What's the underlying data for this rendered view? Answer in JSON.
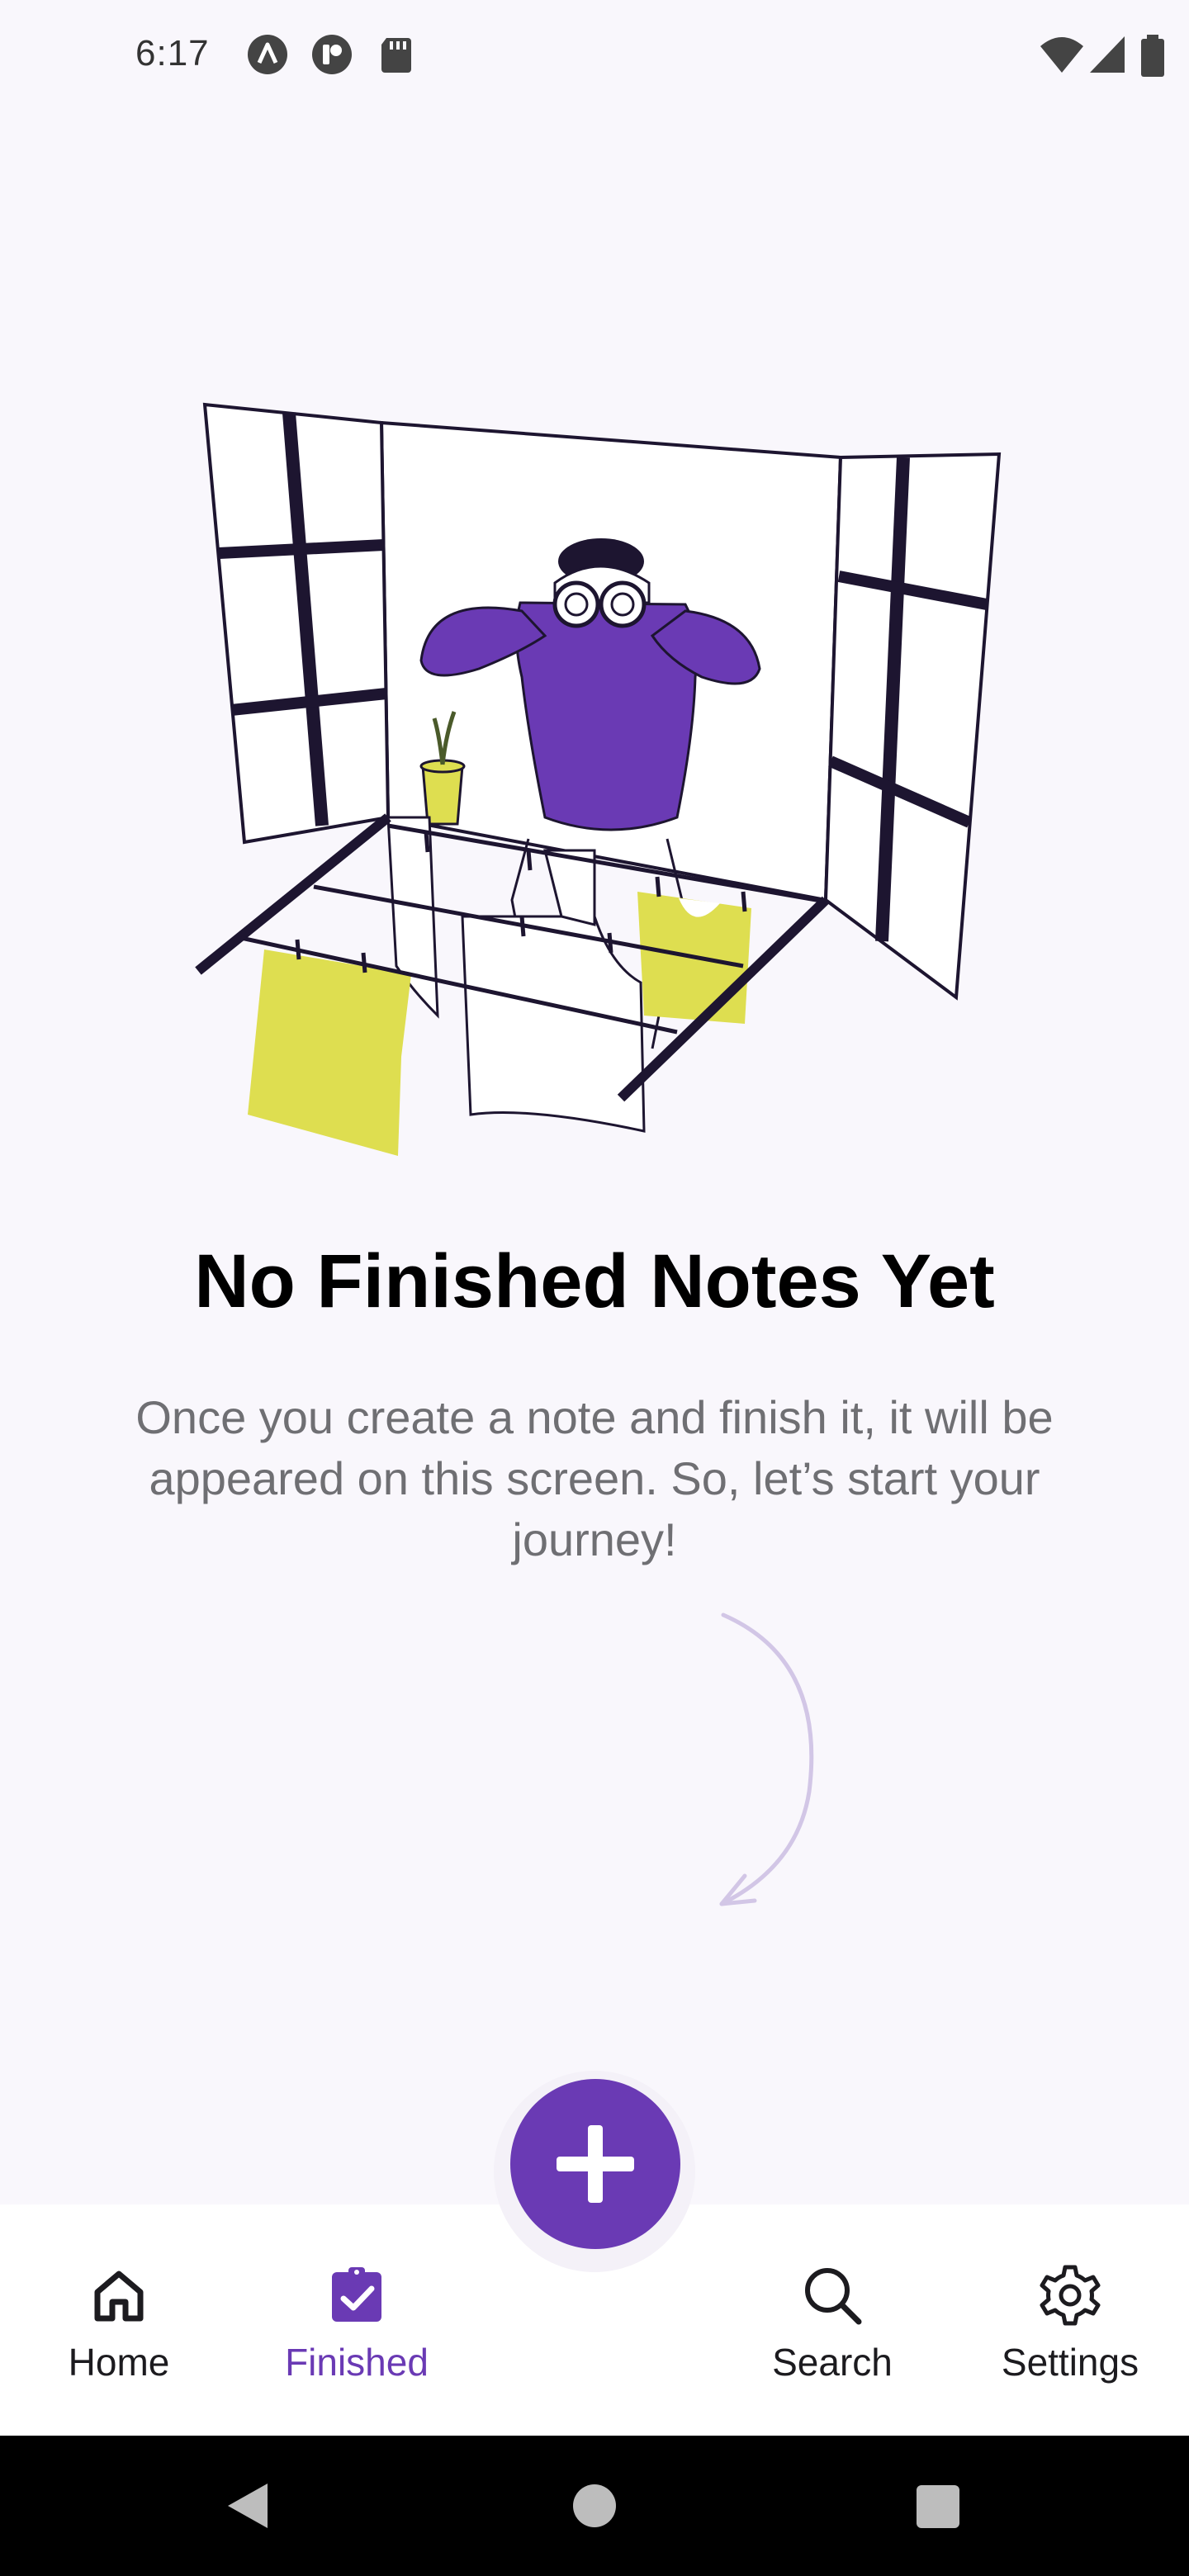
{
  "status_bar": {
    "time": "6:17",
    "left_icons": [
      "nearby-share-icon",
      "accessibility-app-icon",
      "sd-card-icon"
    ],
    "right_icons": [
      "wifi-icon",
      "cellular-signal-icon",
      "battery-icon"
    ]
  },
  "empty_state": {
    "title": "No Finished Notes Yet",
    "description": "Once you create a note and finish it, it will be appeared on this screen. So, let’s start your journey!"
  },
  "fab": {
    "icon": "plus-icon",
    "color": "#6a3ab4"
  },
  "bottom_nav": {
    "items": [
      {
        "label": "Home",
        "icon": "home-icon",
        "active": false
      },
      {
        "label": "Finished",
        "icon": "checklist-icon",
        "active": true
      },
      {
        "label": "Search",
        "icon": "search-icon",
        "active": false
      },
      {
        "label": "Settings",
        "icon": "gear-icon",
        "active": false
      }
    ]
  },
  "system_nav": {
    "icons": [
      "back-icon",
      "home-circle-icon",
      "recents-icon"
    ]
  },
  "colors": {
    "accent": "#6a3ab4",
    "illustration_yellow": "#dede50",
    "background": "#f9f7fc"
  }
}
